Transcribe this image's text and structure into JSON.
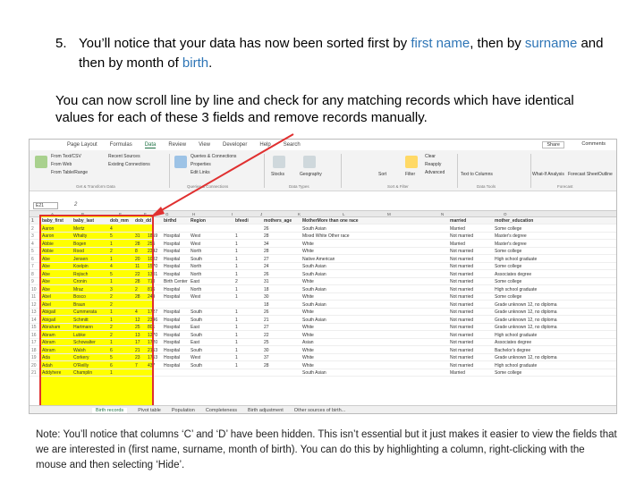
{
  "instructions": {
    "step_number": "5.",
    "step_text_1": "You’ll notice that your data has now been sorted first by ",
    "step_hl_1": "first name",
    "step_text_2": ", then by ",
    "step_hl_2": "surname",
    "step_text_3": " and then by month of ",
    "step_hl_3": "birth",
    "step_text_4": ".",
    "paragraph": "You can now scroll line by line and check for any matching records which have identical values for each of these 3 fields and remove records manually.",
    "note": "Note: You’ll notice that columns ‘C’ and ‘D’ have been hidden. This isn’t essential but it just makes it easier to view the fields that we are interested in (first name, surname, month of birth). You can do this by highlighting a column, right-clicking with the mouse and then selecting ‘Hide’."
  },
  "excel": {
    "tabs": [
      "Page Layout",
      "Formulas",
      "Data",
      "Review",
      "View",
      "Developer",
      "Help",
      "Search"
    ],
    "share": "Share",
    "comments": "Comments",
    "ribbon": {
      "get_transform": [
        "From Text/CSV",
        "From Web",
        "From Table/Range"
      ],
      "recent": [
        "Recent Sources",
        "Existing Connections"
      ],
      "queries": [
        "Queries & Connections",
        "Properties",
        "Edit Links"
      ],
      "types": [
        "Stocks",
        "Geography"
      ],
      "sort": [
        "Sort",
        "Filter",
        "Clear",
        "Reapply",
        "Advanced"
      ],
      "tools": [
        "Text to Columns",
        "What-If Analysis",
        "Forecast Sheet",
        "Outline"
      ],
      "groups": [
        "Get & Transform Data",
        "Queries & Connections",
        "Data Types",
        "Sort & Filter",
        "Data Tools",
        "Forecast"
      ]
    },
    "name_box": "E21",
    "formula": "2",
    "col_headers": [
      "A",
      "B",
      "E",
      "F",
      "G",
      "H",
      "I",
      "J",
      "K",
      "L",
      "M",
      "N",
      "O"
    ],
    "header_row": [
      "baby_first",
      "baby_last",
      "dob_mm",
      "dob_dd",
      "birthd",
      "Region",
      "bfeedi",
      "mothers_age",
      "MotherMore than one race",
      "married",
      "mother_education"
    ],
    "rows": [
      [
        "Aaron",
        "Mertz",
        "4",
        "",
        "",
        "",
        "",
        "26",
        "South Asian",
        "Married",
        "Some college"
      ],
      [
        "Aaron",
        "Whalty",
        "5",
        "31",
        "1859",
        "Hospital",
        "West",
        "1",
        "28",
        "Mixed White Other race",
        "Not married",
        "Master's degree"
      ],
      [
        "Abbie",
        "Bogen",
        "1",
        "28",
        "255",
        "Hospital",
        "West",
        "1",
        "34",
        "White",
        "Married",
        "Master's degree"
      ],
      [
        "Abbie",
        "Rood",
        "2",
        "8",
        "2342",
        "Hospital",
        "North",
        "1",
        "28",
        "White",
        "Not married",
        "Some college"
      ],
      [
        "Abe",
        "Jensen",
        "1",
        "20",
        "1002",
        "Hospital",
        "South",
        "1",
        "27",
        "Native American",
        "Not married",
        "High school graduate"
      ],
      [
        "Abe",
        "Koelpin",
        "4",
        "11",
        "1570",
        "Hospital",
        "North",
        "1",
        "24",
        "South Asian",
        "Not married",
        "Some college"
      ],
      [
        "Abe",
        "Rojisch",
        "5",
        "22",
        "1301",
        "Hospital",
        "North",
        "1",
        "26",
        "South Asian",
        "Not married",
        "Associates degree"
      ],
      [
        "Abe",
        "Cronin",
        "1",
        "28",
        "710",
        "Birth Center",
        "East",
        "2",
        "31",
        "White",
        "Not married",
        "Some college"
      ],
      [
        "Abe",
        "Mraz",
        "3",
        "2",
        "816",
        "Hospital",
        "North",
        "1",
        "18",
        "South Asian",
        "Not married",
        "High school graduate"
      ],
      [
        "Abel",
        "Bosco",
        "2",
        "28",
        "249",
        "Hospital",
        "West",
        "1",
        "30",
        "White",
        "Not married",
        "Some college"
      ],
      [
        "Abel",
        "Braun",
        "2",
        "",
        "",
        "",
        "",
        "18",
        "South Asian",
        "Not married",
        "Grade unknown 12, no diploma"
      ],
      [
        "Abigail",
        "Cummerata",
        "1",
        "4",
        "1727",
        "Hospital",
        "South",
        "1",
        "26",
        "White",
        "Not married",
        "Grade unknown 12, no diploma"
      ],
      [
        "Abigail",
        "Schmitt",
        "1",
        "12",
        "2346",
        "Hospital",
        "South",
        "1",
        "21",
        "South Asian",
        "Not married",
        "Grade unknown 12, no diploma"
      ],
      [
        "Abraham",
        "Hartmann",
        "2",
        "25",
        "801",
        "Hospital",
        "East",
        "1",
        "27",
        "White",
        "Not married",
        "Grade unknown 12, no diploma"
      ],
      [
        "Abram",
        "Lubke",
        "2",
        "13",
        "1270",
        "Hospital",
        "South",
        "1",
        "22",
        "White",
        "Not married",
        "High school graduate"
      ],
      [
        "Abram",
        "Schowalter",
        "1",
        "17",
        "1720",
        "Hospital",
        "East",
        "1",
        "25",
        "Asian",
        "Not married",
        "Associates degree"
      ],
      [
        "Abram",
        "Walsh",
        "6",
        "21",
        "2153",
        "Hospital",
        "South",
        "1",
        "30",
        "White",
        "Not married",
        "Bachelor's degree"
      ],
      [
        "Ada",
        "Corkery",
        "5",
        "23",
        "1753",
        "Hospital",
        "West",
        "1",
        "37",
        "White",
        "Not married",
        "Grade unknown 12, no diploma"
      ],
      [
        "Adah",
        "O'Reilly",
        "6",
        "7",
        "437",
        "Hospital",
        "South",
        "1",
        "28",
        "White",
        "Not married",
        "High school graduate"
      ],
      [
        "Addyhere",
        "Champlin",
        "1",
        "",
        "",
        "",
        "",
        "",
        "South Asian",
        "Married",
        "Some college"
      ]
    ],
    "sheet_tabs": [
      "Birth records",
      "Pivot table",
      "Population",
      "Completeness",
      "Birth adjustment",
      "Other sources of birth..."
    ]
  }
}
